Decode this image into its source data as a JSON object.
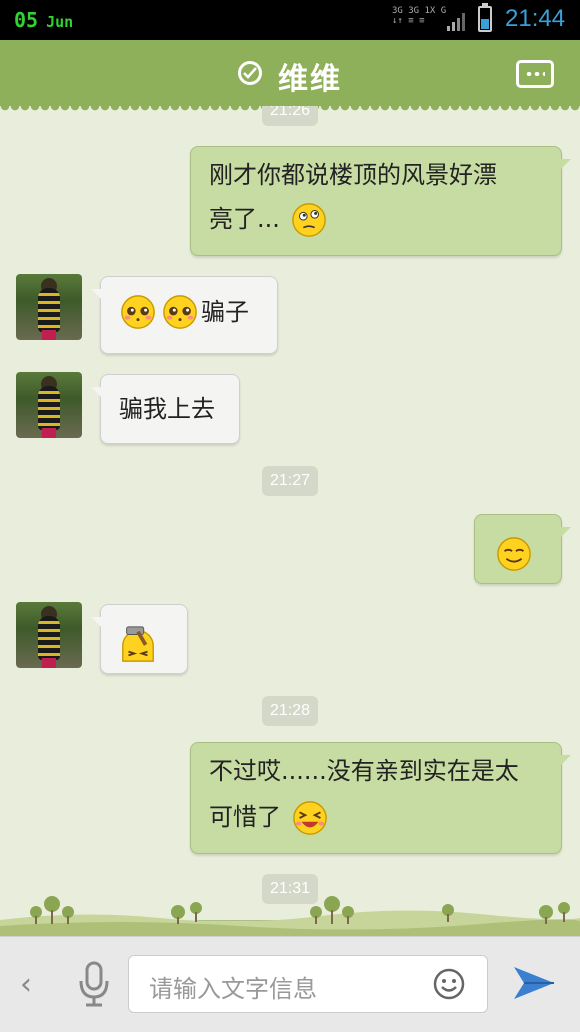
{
  "status_bar": {
    "date": "05",
    "month": "Jun",
    "network": [
      "3G 3G 1X G",
      "↓↑ ≡ ≡"
    ],
    "time": "21:44",
    "accent": "#3aa0d8"
  },
  "header": {
    "title": "维维",
    "icons": [
      "check-circle-icon",
      "more-menu-icon"
    ],
    "color": "#8fb05a"
  },
  "messages": {
    "ts0": "21:26",
    "m1_line1": "刚才你都说楼顶的风景好漂",
    "m1_line2": "亮了...",
    "m2": "骗子",
    "m3": "骗我上去",
    "ts1": "21:27",
    "ts2": "21:28",
    "m6_line1": "不过哎......没有亲到实在是太",
    "m6_line2": "可惜了",
    "ts3": "21:31"
  },
  "input": {
    "placeholder": "请输入文字信息"
  }
}
